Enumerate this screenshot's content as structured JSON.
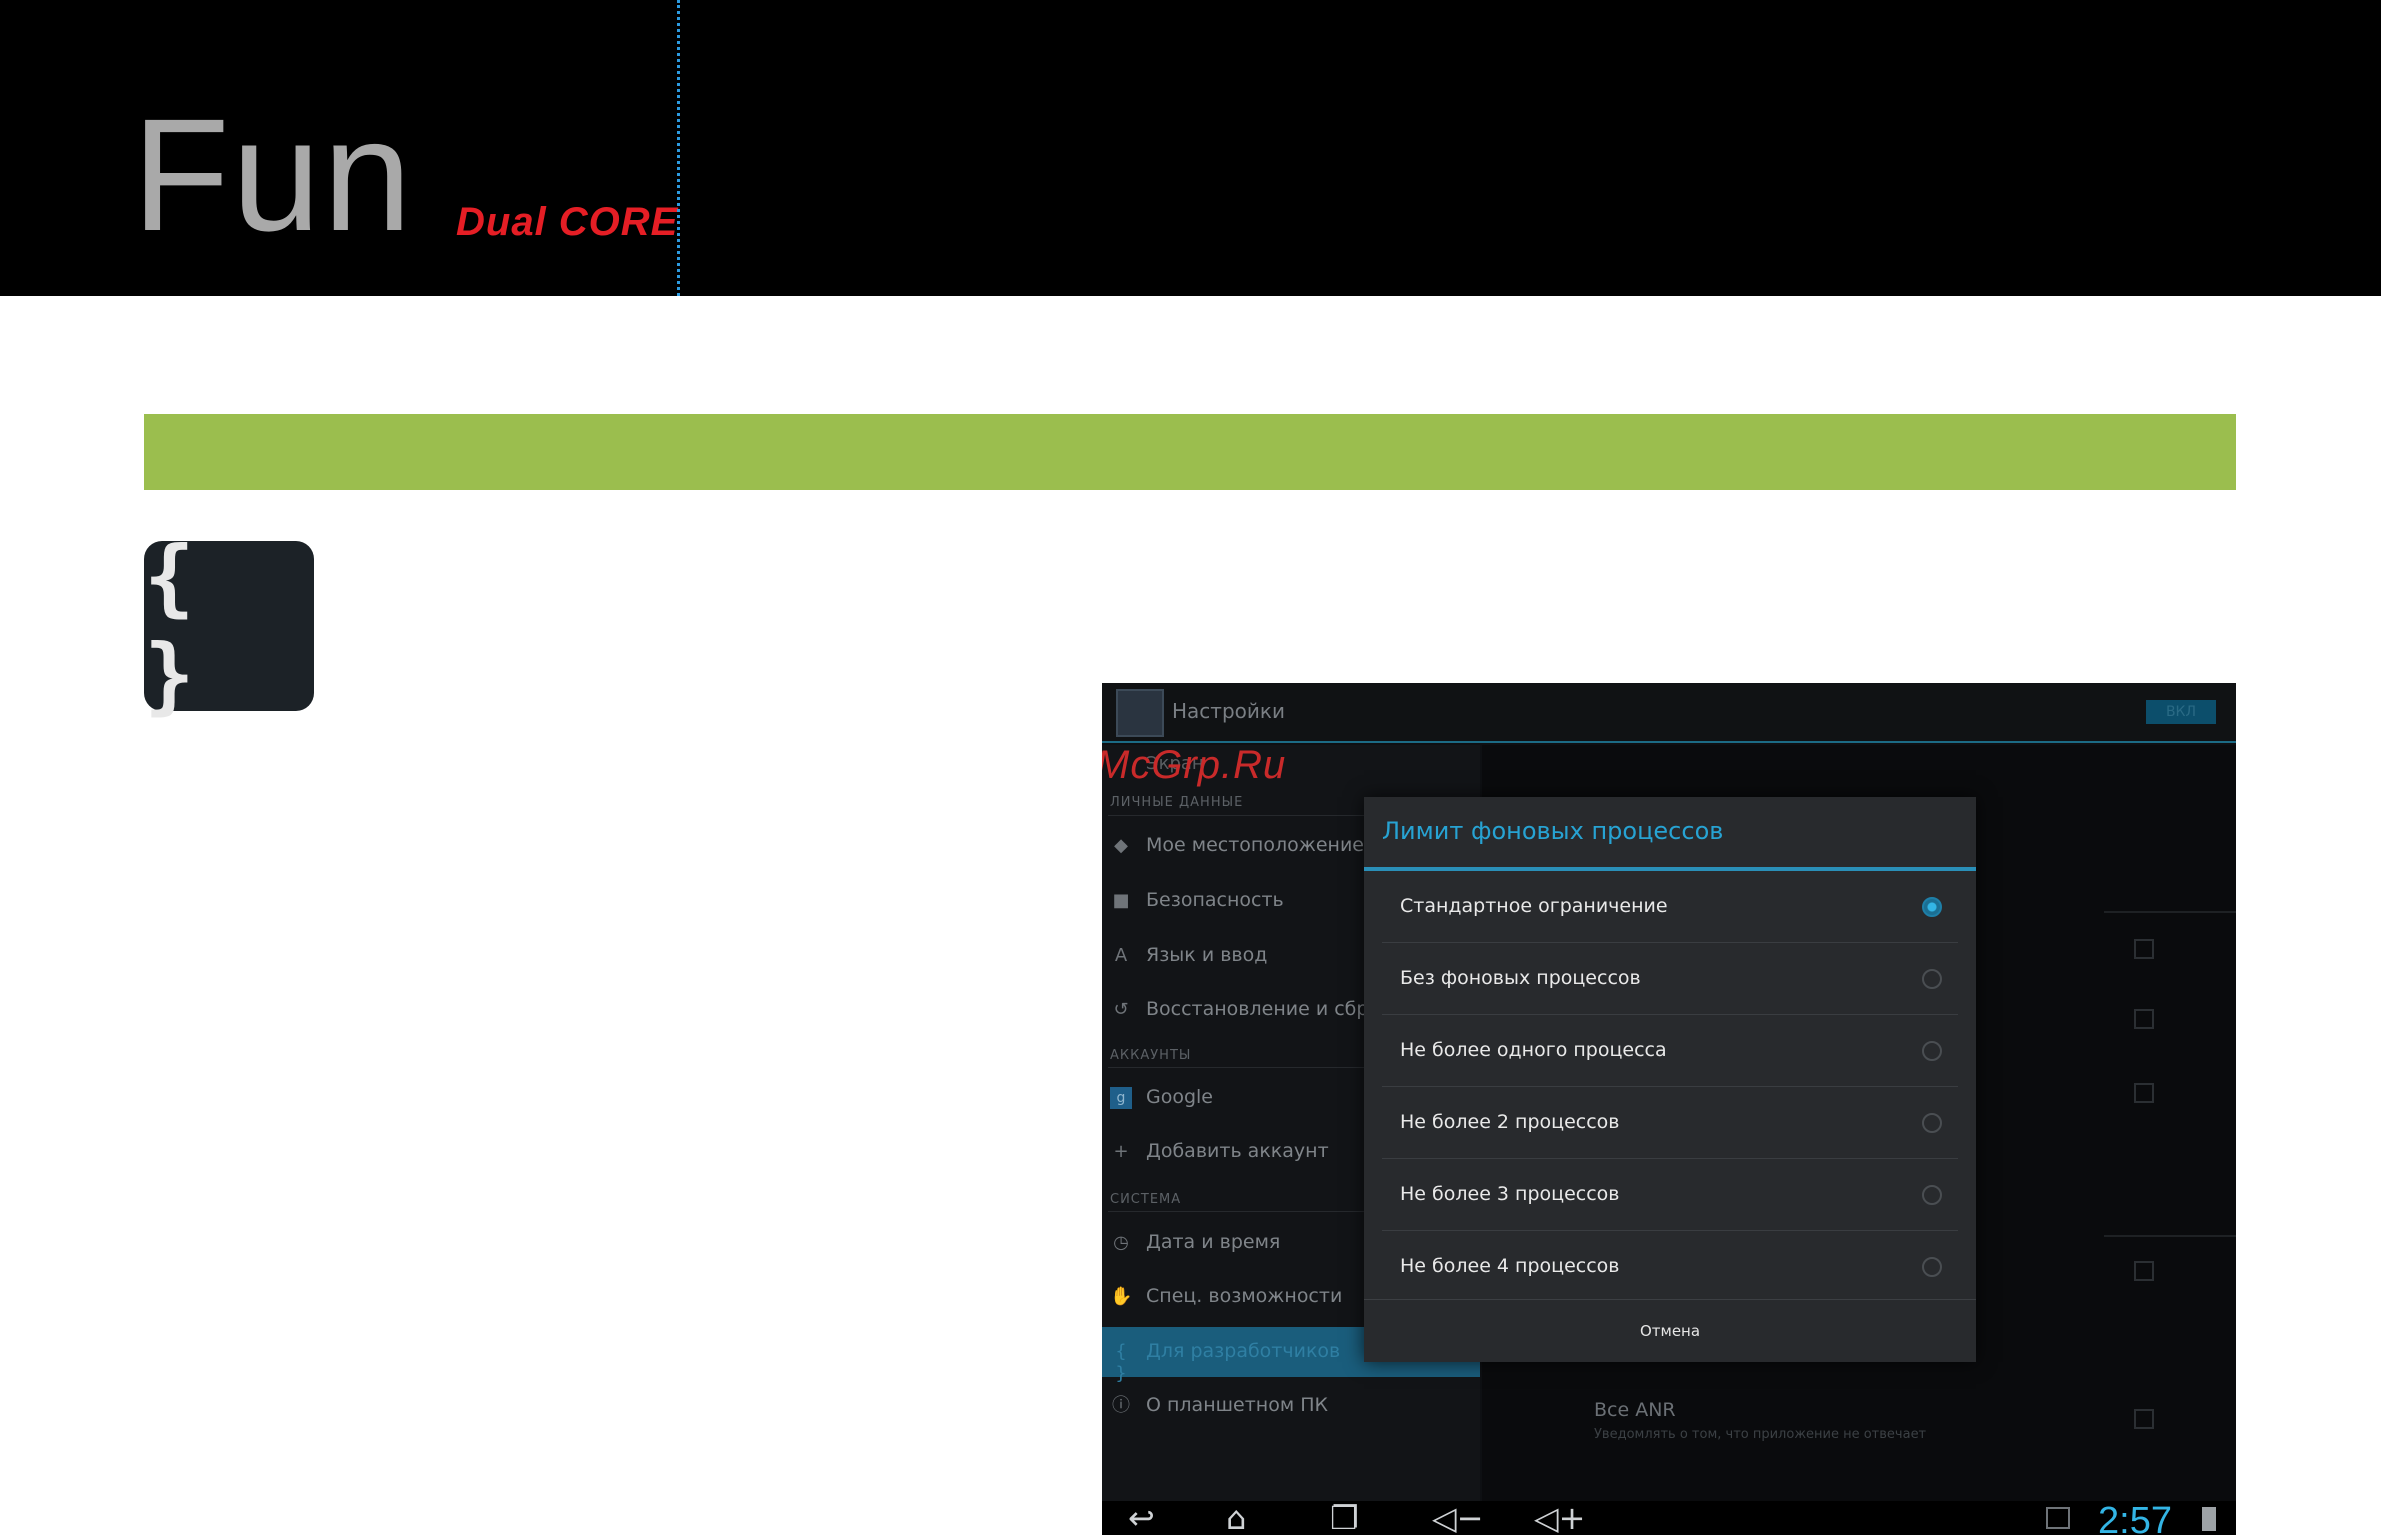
{
  "header": {
    "brand": "Fun",
    "brand_sub": "Dual CORE"
  },
  "dev_icon": {
    "glyph": "{ }"
  },
  "screenshot": {
    "action_bar": {
      "title": "Настройки",
      "switch_label": "ВКЛ"
    },
    "watermark": "McGrp.Ru",
    "watermark_under": "Экран",
    "sections": {
      "personal": "ЛИЧНЫЕ ДАННЫЕ",
      "accounts": "АККАУНТЫ",
      "system": "СИСТЕМА"
    },
    "menu": {
      "location": "Мое местоположение",
      "security": "Безопасность",
      "language": "Язык и ввод",
      "backup": "Восстановление и сброс",
      "google": "Google",
      "add_account": "Добавить аккаунт",
      "date_time": "Дата и время",
      "accessibility": "Спец. возможности",
      "developer": "Для разработчиков",
      "about": "О планшетном ПК"
    },
    "right_pane": {
      "anr_title": "Все ANR",
      "anr_subtitle": "Уведомлять о том, что приложение не отвечает"
    },
    "dialog": {
      "title": "Лимит фоновых процессов",
      "options": [
        "Стандартное ограничение",
        "Без фоновых процессов",
        "Не более одного процесса",
        "Не более 2 процессов",
        "Не более 3 процессов",
        "Не более 4 процессов"
      ],
      "selected_index": 0,
      "cancel": "Отмена"
    },
    "system_bar": {
      "time": "2:57"
    }
  },
  "colors": {
    "header_bg": "#000000",
    "brand_sub": "#e51e25",
    "green_bar": "#9bbe4e",
    "holo_blue": "#33b5e5"
  }
}
